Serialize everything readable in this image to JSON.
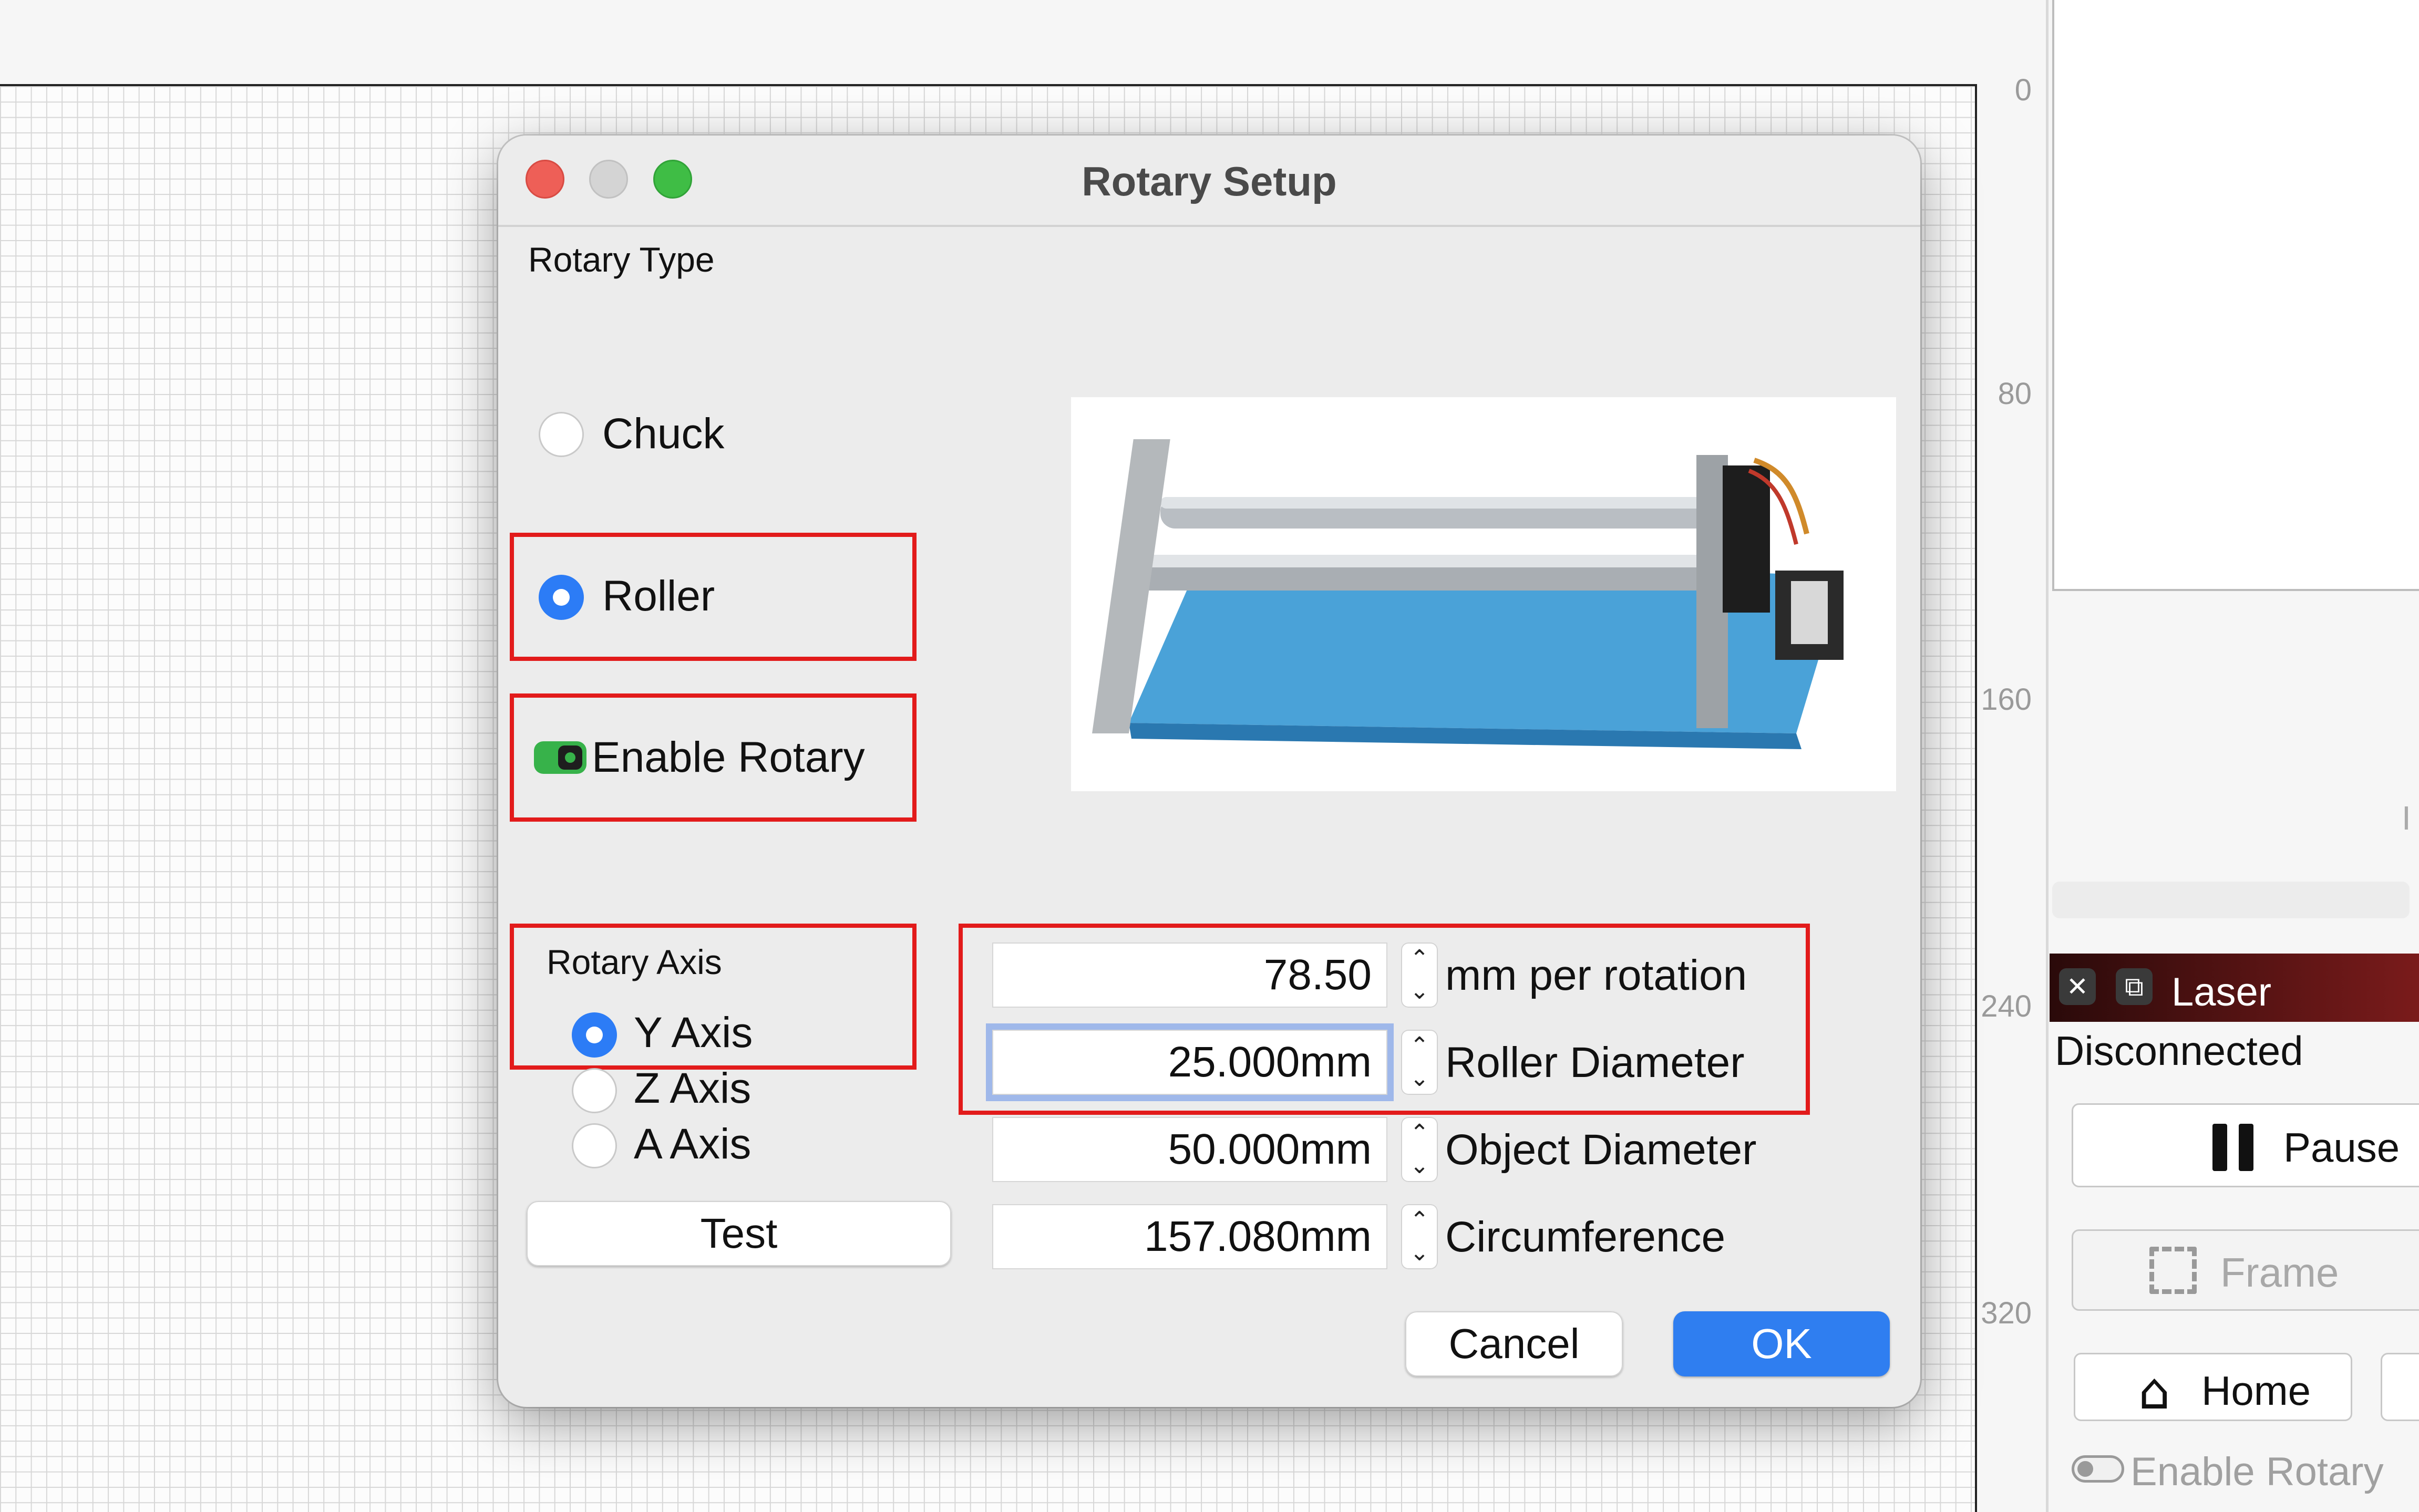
{
  "colors": {
    "accent": "#2c7cf6",
    "highlight_box": "#e21b1b",
    "toggle_on": "#37b24a",
    "laser_header": "#5a1414"
  },
  "ruler": {
    "ticks": [
      "0",
      "80",
      "160",
      "240",
      "320"
    ]
  },
  "dialog": {
    "title": "Rotary Setup",
    "rotary_type_label": "Rotary Type",
    "types": [
      {
        "label": "Chuck",
        "selected": false
      },
      {
        "label": "Roller",
        "selected": true
      }
    ],
    "enable_rotary": {
      "label": "Enable Rotary",
      "on": true
    },
    "rotary_axis_label": "Rotary Axis",
    "axes": [
      {
        "label": "Y Axis",
        "selected": true
      },
      {
        "label": "Z Axis",
        "selected": false
      },
      {
        "label": "A Axis",
        "selected": false
      }
    ],
    "test_label": "Test",
    "fields": [
      {
        "value": "78.50",
        "label": "mm per rotation"
      },
      {
        "value": "25.000mm",
        "label": "Roller Diameter"
      },
      {
        "value": "50.000mm",
        "label": "Object Diameter"
      },
      {
        "value": "157.080mm",
        "label": "Circumference"
      }
    ],
    "cancel_label": "Cancel",
    "ok_label": "OK"
  },
  "side_panel": {
    "clipped_text": "I",
    "laser": {
      "title": "Laser",
      "status": "Disconnected",
      "pause_label": "Pause",
      "frame_label": "Frame",
      "home_label": "Home",
      "enable_rotary_label": "Enable Rotary"
    }
  }
}
